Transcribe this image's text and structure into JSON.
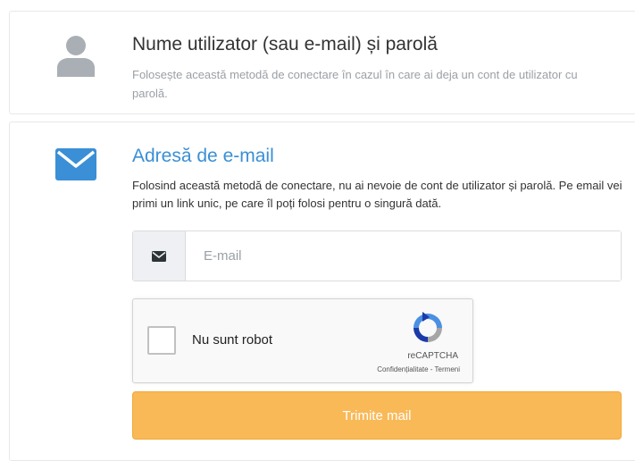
{
  "login_options": {
    "password_option": {
      "title": "Nume utilizator (sau e-mail) și parolă",
      "description": "Folosește această metodă de conectare în cazul în care ai deja un cont de utilizator cu parolă.",
      "icon": "user-icon"
    },
    "email_option": {
      "title": "Adresă de e-mail",
      "description": "Folosind această metodă de conectare, nu ai nevoie de cont de utilizator și parolă. Pe email vei primi un link unic, pe care îl poți folosi pentru o singură dată.",
      "icon": "envelope-icon",
      "email_field": {
        "placeholder": "E-mail",
        "value": "",
        "icon": "envelope-icon"
      },
      "captcha": {
        "checkbox_label": "Nu sunt robot",
        "brand": "reCAPTCHA",
        "links": "Confidențialitate - Termeni",
        "checked": false
      },
      "submit_label": "Trimite mail"
    }
  },
  "colors": {
    "accent_blue": "#3a8fd6",
    "submit_orange": "#f9b957",
    "muted_text": "#9aa0a6",
    "user_icon_gray": "#a9afb5"
  }
}
